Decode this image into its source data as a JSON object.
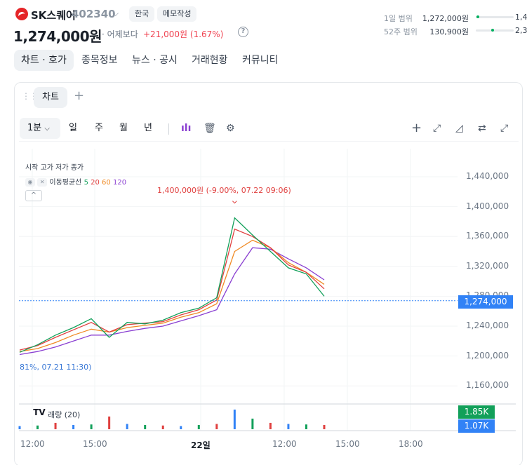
{
  "header": {
    "stock_name": "SK스퀘어",
    "stock_code": "402340",
    "market_pill": "한국",
    "memo_pill": "메모작성",
    "price": "1,274,000원",
    "prev_label": "· 어제보다",
    "change": "+21,000원 (1.67%)",
    "help_icon": "?"
  },
  "ranges": [
    {
      "label": "1일 범위",
      "value": "1,272,000원",
      "fraction": 0.02,
      "right_value": "1,4"
    },
    {
      "label": "52주 범위",
      "value": "130,900원",
      "fraction": 0.4,
      "right_value": "2,3"
    }
  ],
  "tabs": [
    {
      "label": "차트 · 호가",
      "active": true
    },
    {
      "label": "종목정보",
      "active": false
    },
    {
      "label": "뉴스 · 공시",
      "active": false
    },
    {
      "label": "거래현황",
      "active": false
    },
    {
      "label": "커뮤니티",
      "active": false
    }
  ],
  "chart_panel": {
    "tab_label": "차트",
    "add_tab": "+",
    "timeframes": {
      "selected": "1분",
      "options": [
        "일",
        "주",
        "월",
        "년"
      ]
    },
    "tool_icons": [
      "candles-icon",
      "trash-icon",
      "gear-icon",
      "crosshair-plus-icon",
      "line-tool-icon",
      "triangle-tool-icon",
      "swap-icon",
      "expand-icon"
    ]
  },
  "legend": {
    "ohlc_label": "시작 고가 저가 종가",
    "ma_label": "이동평균선",
    "ma_periods": [
      {
        "value": "5",
        "color": "#12a05a"
      },
      {
        "value": "20",
        "color": "#e0403f"
      },
      {
        "value": "60",
        "color": "#f08a24"
      },
      {
        "value": "120",
        "color": "#8a3fd1"
      }
    ],
    "collapse_icon": "^"
  },
  "annotations": {
    "high": "1,400,000원 (-9.00%, 07.22 09:06)",
    "low": "81%, 07.21 11:30)"
  },
  "volume_label": "래량 (20)",
  "current_price_tag": "1,274,000",
  "volume_tags": [
    "1.85K",
    "1.07K"
  ],
  "y_axis": [
    "1,440,000",
    "1,400,000",
    "1,360,000",
    "1,320,000",
    "1,280,000",
    "1,240,000",
    "1,200,000",
    "1,160,000"
  ],
  "x_axis": [
    {
      "label": "12:00",
      "bold": false
    },
    {
      "label": "15:00",
      "bold": false
    },
    {
      "label": "22일",
      "bold": true
    },
    {
      "label": "12:00",
      "bold": false
    },
    {
      "label": "15:00",
      "bold": false
    },
    {
      "label": "18:00",
      "bold": false
    }
  ],
  "chart_data": {
    "type": "line",
    "title": "",
    "xlabel": "",
    "ylabel": "",
    "ylim": [
      1140000,
      1460000
    ],
    "x": [
      "07.21 10:00",
      "07.21 11:00",
      "07.21 12:00",
      "07.21 13:00",
      "07.21 14:00",
      "07.21 15:00",
      "07.21 16:00",
      "07.21 17:00",
      "07.21 18:00",
      "07.21 19:00",
      "07.21 20:00",
      "07.22 08:00",
      "07.22 09:06",
      "07.22 10:00",
      "07.22 11:00",
      "07.22 12:00",
      "07.22 13:00",
      "07.22 14:00"
    ],
    "series": [
      {
        "name": "5",
        "color": "#12a05a",
        "values": [
          1205000,
          1215000,
          1228000,
          1238000,
          1250000,
          1225000,
          1245000,
          1243000,
          1248000,
          1258000,
          1264000,
          1278000,
          1385000,
          1362000,
          1340000,
          1318000,
          1310000,
          1280000
        ]
      },
      {
        "name": "20",
        "color": "#e0403f",
        "values": [
          1208000,
          1214000,
          1225000,
          1235000,
          1245000,
          1232000,
          1242000,
          1244000,
          1246000,
          1255000,
          1262000,
          1275000,
          1370000,
          1360000,
          1345000,
          1322000,
          1312000,
          1290000
        ]
      },
      {
        "name": "60",
        "color": "#f08a24",
        "values": [
          1206000,
          1210000,
          1218000,
          1228000,
          1236000,
          1232000,
          1238000,
          1241000,
          1244000,
          1252000,
          1258000,
          1270000,
          1340000,
          1355000,
          1345000,
          1325000,
          1312000,
          1296000
        ]
      },
      {
        "name": "120",
        "color": "#8a3fd1",
        "values": [
          1202000,
          1206000,
          1212000,
          1220000,
          1228000,
          1228000,
          1233000,
          1237000,
          1240000,
          1247000,
          1254000,
          1262000,
          1310000,
          1345000,
          1343000,
          1330000,
          1318000,
          1302000
        ]
      }
    ],
    "volume": {
      "name": "래량 (20)",
      "values": [
        0.3,
        0.35,
        0.6,
        0.4,
        0.45,
        1.2,
        0.5,
        0.4,
        0.35,
        0.3,
        0.4,
        0.5,
        1.85,
        1.0,
        0.6,
        0.5,
        0.45,
        0.4
      ]
    },
    "current_price": 1274000,
    "high": {
      "value": 1400000,
      "time": "07.22 09:06"
    },
    "legend_placement": "top-left",
    "grid": true
  }
}
